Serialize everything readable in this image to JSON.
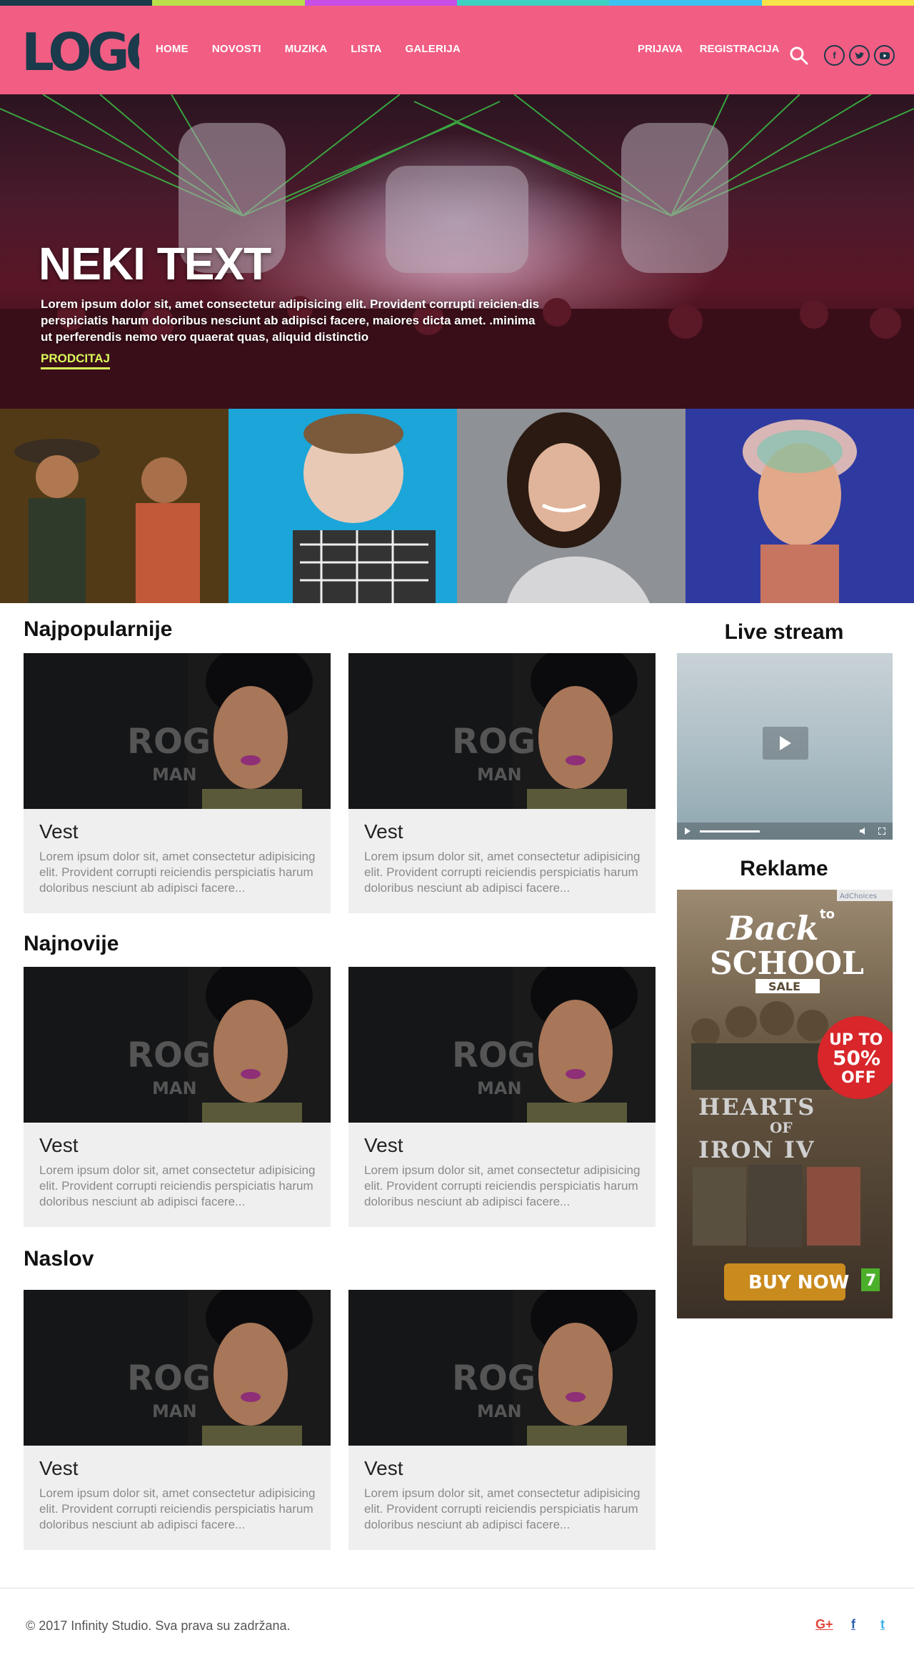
{
  "colors": {
    "header_bg": "#f25d83",
    "logo": "#1b3a4b",
    "hero_link": "#d9f95a",
    "card_bg": "#efefef",
    "strip": [
      "#1b3a4b",
      "#b9e04a",
      "#c84ee8",
      "#3fd1c0",
      "#3ec1f0",
      "#f7e34a"
    ]
  },
  "header": {
    "logo_text": "LOGO",
    "nav": [
      "HOME",
      "NOVOSTI",
      "MUZIKA",
      "LISTA",
      "GALERIJA"
    ],
    "auth": [
      "PRIJAVA",
      "REGISTRACIJA"
    ],
    "icons": [
      "search-icon",
      "facebook-icon",
      "twitter-icon",
      "youtube-icon"
    ]
  },
  "hero": {
    "title": "NEKI TEXT",
    "text": "Lorem ipsum dolor sit, amet consectetur adipisicing elit. Provident corrupti reicien-dis perspiciatis harum doloribus nesciunt ab adipisci facere, maiores dicta amet. .minima ut perferendis nemo vero quaerat quas, aliquid distinctio",
    "link": "PRODCITAJ"
  },
  "sections": [
    {
      "title": "Najpopularnije",
      "cards": [
        {
          "title": "Vest",
          "text": "Lorem ipsum dolor sit, amet consectetur adipisicing elit. Provident corrupti reiciendis perspiciatis harum doloribus nesciunt ab adipisci facere..."
        },
        {
          "title": "Vest",
          "text": "Lorem ipsum dolor sit, amet consectetur adipisicing elit. Provident corrupti reiciendis perspiciatis harum doloribus nesciunt ab adipisci facere..."
        }
      ]
    },
    {
      "title": "Najnovije",
      "cards": [
        {
          "title": "Vest",
          "text": "Lorem ipsum dolor sit, amet consectetur adipisicing elit. Provident corrupti reiciendis perspiciatis harum doloribus nesciunt ab adipisci facere..."
        },
        {
          "title": "Vest",
          "text": "Lorem ipsum dolor sit, amet consectetur adipisicing elit. Provident corrupti reiciendis perspiciatis harum doloribus nesciunt ab adipisci facere..."
        }
      ]
    },
    {
      "title": "Naslov",
      "cards": [
        {
          "title": "Vest",
          "text": "Lorem ipsum dolor sit, amet consectetur adipisicing elit. Provident corrupti reiciendis perspiciatis harum doloribus nesciunt ab adipisci facere..."
        },
        {
          "title": "Vest",
          "text": "Lorem ipsum dolor sit, amet consectetur adipisicing elit. Provident corrupti reiciendis perspiciatis harum doloribus nesciunt ab adipisci facere..."
        }
      ]
    }
  ],
  "card_image_text": {
    "line1": "ROGUE",
    "line2": "MAN"
  },
  "sidebar": {
    "live_title": "Live stream",
    "ads_title": "Reklame",
    "ad": {
      "badge": "AdChoices",
      "line1": "Back",
      "to": "to",
      "line2": "SCHOOL",
      "sale": "SALE",
      "promo1": "UP TO",
      "promo2": "50%",
      "promo3": "OFF",
      "game1": "HEARTS",
      "game2": "OF",
      "game3": "IRON IV",
      "cta": "BUY NOW",
      "rating": "7"
    }
  },
  "footer": {
    "copyright": "© 2017 Infinity Studio. Sva prava su zadržana.",
    "social": [
      "G+",
      "f",
      "t"
    ]
  }
}
